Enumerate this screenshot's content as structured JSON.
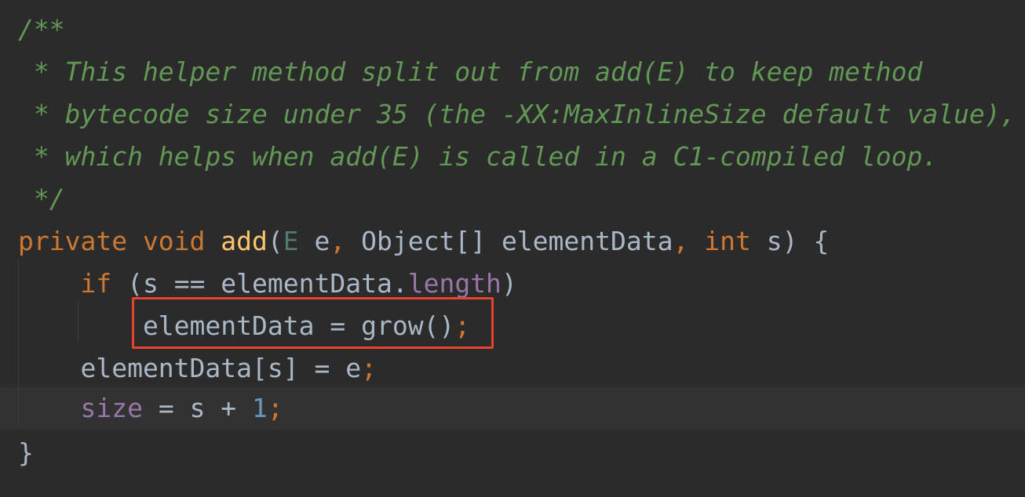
{
  "editor": {
    "lines": [
      {
        "segments": [
          {
            "text": "/**",
            "cls": "doc"
          }
        ]
      },
      {
        "segments": [
          {
            "text": " * This helper method split out from add(E) to keep method",
            "cls": "doc"
          }
        ]
      },
      {
        "segments": [
          {
            "text": " * bytecode size under 35 (the -XX:MaxInlineSize default value),",
            "cls": "doc"
          }
        ]
      },
      {
        "segments": [
          {
            "text": " * which helps when add(E) is called in a C1-compiled loop.",
            "cls": "doc"
          }
        ]
      },
      {
        "segments": [
          {
            "text": " */",
            "cls": "doc"
          }
        ]
      },
      {
        "segments": [
          {
            "text": "private void ",
            "cls": "kw"
          },
          {
            "text": "add",
            "cls": "fn"
          },
          {
            "text": "(",
            "cls": "plain"
          },
          {
            "text": "E",
            "cls": "tparam"
          },
          {
            "text": " e",
            "cls": "plain"
          },
          {
            "text": ", ",
            "cls": "kw"
          },
          {
            "text": "Object[] elementData",
            "cls": "plain"
          },
          {
            "text": ", ",
            "cls": "kw"
          },
          {
            "text": "int ",
            "cls": "kw"
          },
          {
            "text": "s) {",
            "cls": "plain"
          }
        ]
      },
      {
        "segments": [
          {
            "text": "    ",
            "cls": "plain"
          },
          {
            "text": "if ",
            "cls": "kw"
          },
          {
            "text": "(s == elementData.",
            "cls": "plain"
          },
          {
            "text": "length",
            "cls": "field"
          },
          {
            "text": ")",
            "cls": "plain"
          }
        ]
      },
      {
        "segments": [
          {
            "text": "        elementData = grow()",
            "cls": "plain"
          },
          {
            "text": ";",
            "cls": "kw"
          }
        ]
      },
      {
        "segments": [
          {
            "text": "    elementData[s] = e",
            "cls": "plain"
          },
          {
            "text": ";",
            "cls": "kw"
          }
        ]
      },
      {
        "segments": [
          {
            "text": "    ",
            "cls": "plain"
          },
          {
            "text": "size",
            "cls": "field"
          },
          {
            "text": " = s + ",
            "cls": "plain"
          },
          {
            "text": "1",
            "cls": "num"
          },
          {
            "text": ";",
            "cls": "kw"
          }
        ]
      },
      {
        "segments": [
          {
            "text": "}",
            "cls": "plain"
          }
        ]
      }
    ],
    "current_line": 10,
    "highlighted_line": 8
  },
  "colors": {
    "background": "#2b2b2b",
    "current_line_background": "#323232",
    "doc_comment": "#629755",
    "keyword": "#cc7832",
    "function_name": "#ffc66d",
    "identifier": "#a9b7c6",
    "field": "#9876aa",
    "number": "#6897bb",
    "type_parameter": "#507874",
    "highlight_box_border": "#e8432e"
  }
}
